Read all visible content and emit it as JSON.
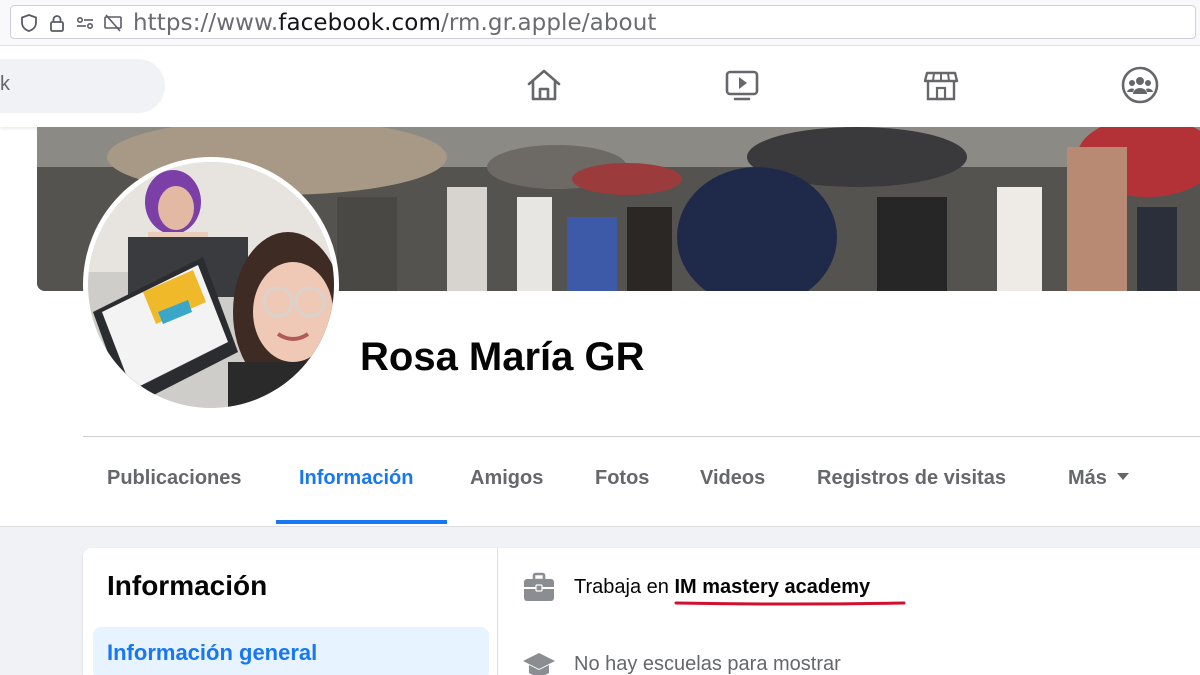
{
  "browser": {
    "url_prefix": "https://www.",
    "url_host": "facebook.com",
    "url_path": "/rm.gr.apple/about"
  },
  "fb_nav": {
    "search_fragment": "k",
    "icons": [
      "home-icon",
      "watch-icon",
      "marketplace-icon",
      "groups-icon"
    ]
  },
  "profile": {
    "name": "Rosa María GR"
  },
  "tabs": [
    {
      "label": "Publicaciones"
    },
    {
      "label": "Información"
    },
    {
      "label": "Amigos"
    },
    {
      "label": "Fotos"
    },
    {
      "label": "Videos"
    },
    {
      "label": "Registros de visitas"
    },
    {
      "label": "Más"
    }
  ],
  "active_tab": "Información",
  "about": {
    "title": "Información",
    "sidebar": [
      {
        "label": "Información general"
      }
    ],
    "work": {
      "prefix": "Trabaja en ",
      "company": "IM mastery academy"
    },
    "education": {
      "text": "No hay escuelas para mostrar"
    }
  },
  "colors": {
    "accent": "#1877f2",
    "highlight_underline": "#d0102f",
    "secondary_text": "#65676b"
  }
}
